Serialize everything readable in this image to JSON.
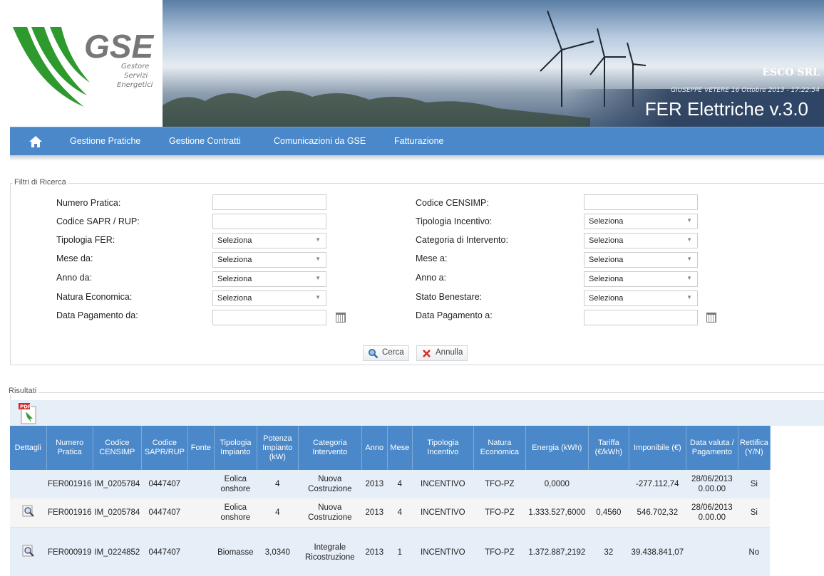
{
  "banner": {
    "logo_text": "GSE",
    "logo_sub": [
      "Gestore",
      "Servizi",
      "Energetici"
    ],
    "org": "ESCO SRL",
    "user_info": "GIUSEPPE VETERE 16 Ottobre 2013 - 17:22:54",
    "app_title": "FER Elettriche  v.3.0"
  },
  "nav": {
    "home_icon": "home-icon",
    "items": [
      "Gestione Pratiche",
      "Gestione Contratti",
      "Comunicazioni da GSE",
      "Fatturazione"
    ]
  },
  "filters": {
    "legend": "Filtri di Ricerca",
    "numero_pratica": "Numero Pratica:",
    "codice_sapr": "Codice SAPR / RUP:",
    "tipologia_fer": "Tipologia FER:",
    "mese_da": "Mese da:",
    "anno_da": "Anno da:",
    "natura": "Natura Economica:",
    "data_pag_da": "Data Pagamento da:",
    "codice_censimp": "Codice CENSIMP:",
    "tipologia_incentivo": "Tipologia Incentivo:",
    "categoria": "Categoria di Intervento:",
    "mese_a": "Mese a:",
    "anno_a": "Anno a:",
    "stato": "Stato Benestare:",
    "data_pag_a": "Data Pagamento a:",
    "select_value": "Seleziona",
    "search_label": "Cerca",
    "cancel_label": "Annulla"
  },
  "results": {
    "legend": "Risultati",
    "headers": [
      "Dettagli",
      "Numero Pratica",
      "Codice CENSIMP",
      "Codice SAPR/RUP",
      "Fonte",
      "Tipologia Impianto",
      "Potenza Impianto (kW)",
      "Categoria Intervento",
      "Anno",
      "Mese",
      "Tipologia Incentivo",
      "Natura Economica",
      "Energia (kWh)",
      "Tariffa (€/kWh)",
      "Imponibile (€)",
      "Data valuta / Pagamento",
      "Rettifica (Y/N)"
    ],
    "rows": [
      {
        "numero": "FER001916",
        "censimp": "IM_0205784",
        "sapr": "0447407",
        "fonte": "",
        "tipologia": "Eolica onshore",
        "potenza": "4",
        "categoria": "Nuova Costruzione",
        "anno": "2013",
        "mese": "4",
        "incentivo": "INCENTIVO",
        "natura": "TFO-PZ",
        "energia": "0,0000",
        "tariffa": "",
        "imponibile": "-277.112,74",
        "data": "28/06/2013 0.00.00",
        "rettifica": "Si"
      },
      {
        "numero": "FER001916",
        "censimp": "IM_0205784",
        "sapr": "0447407",
        "fonte": "",
        "tipologia": "Eolica onshore",
        "potenza": "4",
        "categoria": "Nuova Costruzione",
        "anno": "2013",
        "mese": "4",
        "incentivo": "INCENTIVO",
        "natura": "TFO-PZ",
        "energia": "1.333.527,6000",
        "tariffa": "0,4560",
        "imponibile": "546.702,32",
        "data": "28/06/2013 0.00.00",
        "rettifica": "Si"
      },
      {
        "numero": "FER000919",
        "censimp": "IM_0224852",
        "sapr": "0447407",
        "fonte": "",
        "tipologia": "Biomasse",
        "potenza": "3,0340",
        "categoria": "Integrale Ricostruzione",
        "anno": "2013",
        "mese": "1",
        "incentivo": "INCENTIVO",
        "natura": "TFO-PZ",
        "energia": "1.372.887,2192",
        "tariffa": "32",
        "imponibile": "39.438.841,07",
        "data": "",
        "rettifica": "No"
      }
    ]
  },
  "colors": {
    "nav": "#4a88c9",
    "logo_green": "#2e9a2e",
    "row_alt": "#e6eef7"
  }
}
